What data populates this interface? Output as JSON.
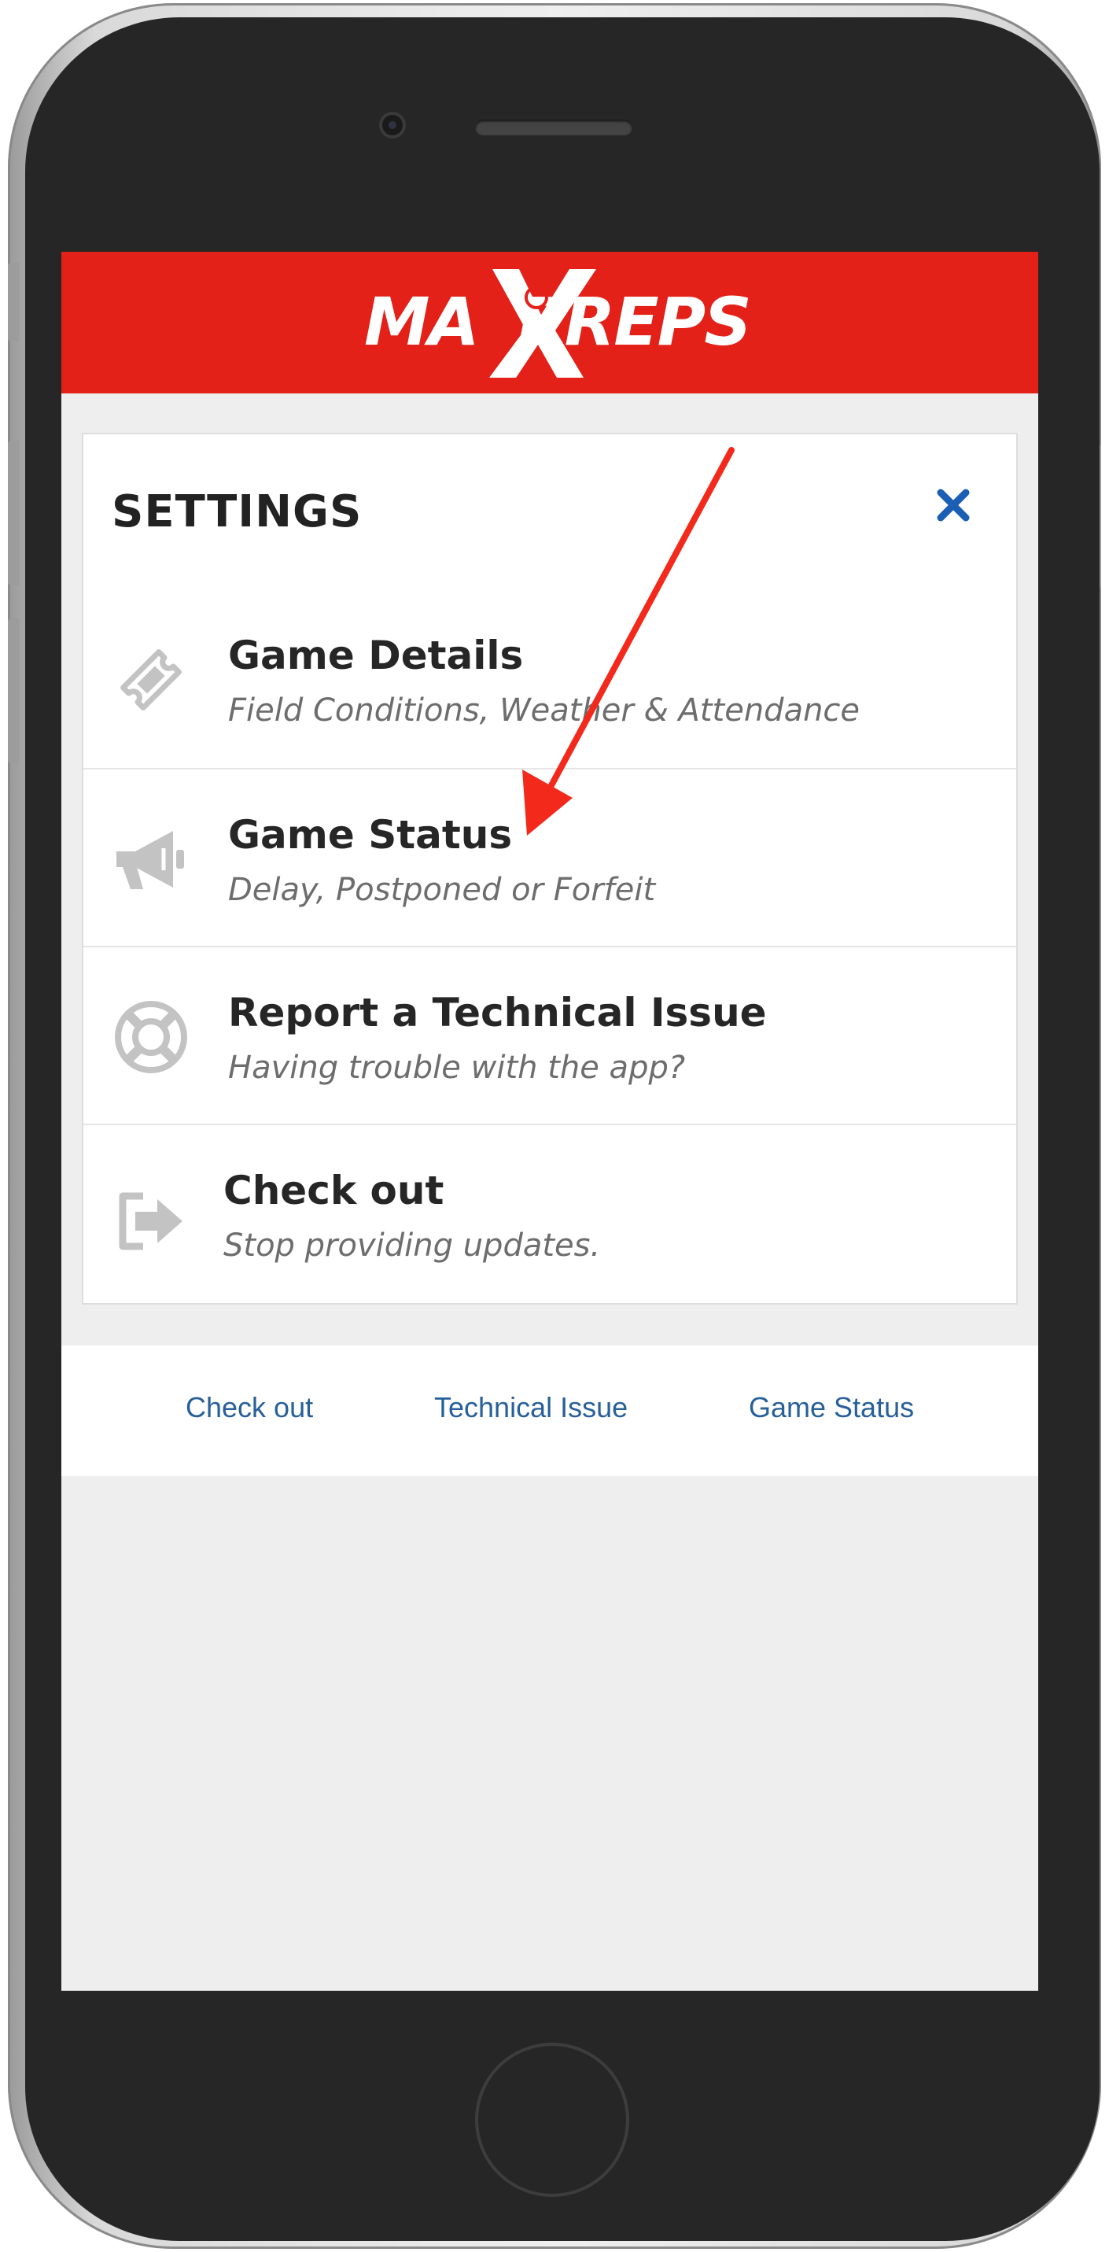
{
  "header": {
    "brand": "MaxPreps"
  },
  "settings": {
    "title": "SETTINGS",
    "close_icon": "close-icon",
    "items": [
      {
        "icon": "ticket-icon",
        "title": "Game Details",
        "subtitle": "Field Conditions, Weather & Attendance"
      },
      {
        "icon": "megaphone-icon",
        "title": "Game Status",
        "subtitle": "Delay, Postponed or Forfeit"
      },
      {
        "icon": "lifebuoy-icon",
        "title": "Report a Technical Issue",
        "subtitle": "Having trouble with the app?"
      },
      {
        "icon": "sign-out-icon",
        "title": "Check out",
        "subtitle": "Stop providing updates."
      }
    ]
  },
  "footer": {
    "links": [
      "Check out",
      "Technical Issue",
      "Game Status"
    ]
  },
  "colors": {
    "brand_red": "#e32118",
    "close_blue": "#1a5fb4",
    "link_blue": "#27609a",
    "annotation_arrow": "#f2291b",
    "icon_gray": "#c3c3c3"
  }
}
